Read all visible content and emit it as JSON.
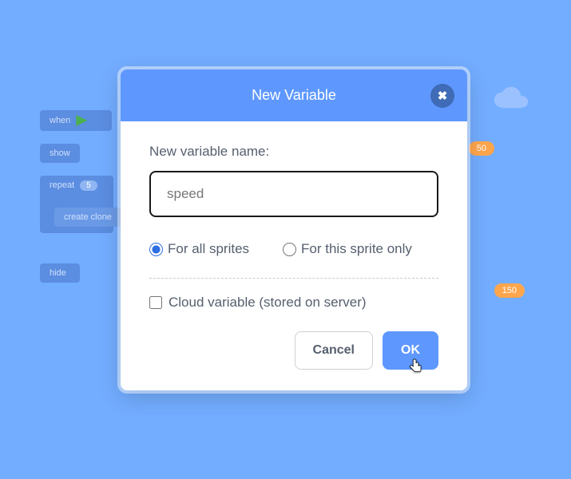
{
  "background": {
    "blocks": {
      "when_clicked": "when",
      "show": "show",
      "repeat": "repeat",
      "repeat_count": "5",
      "create_clone": "create clone",
      "hide": "hide"
    },
    "pills": {
      "top_right": "50",
      "mid_right": "150"
    }
  },
  "modal": {
    "title": "New Variable",
    "close_glyph": "✖",
    "field_label": "New variable name:",
    "input_value": "speed",
    "input_placeholder": "",
    "scope": {
      "all_sprites": "For all sprites",
      "this_sprite": "For this sprite only",
      "selected": "all_sprites"
    },
    "cloud_label": "Cloud variable (stored on server)",
    "cloud_checked": false,
    "buttons": {
      "cancel": "Cancel",
      "ok": "OK"
    }
  }
}
